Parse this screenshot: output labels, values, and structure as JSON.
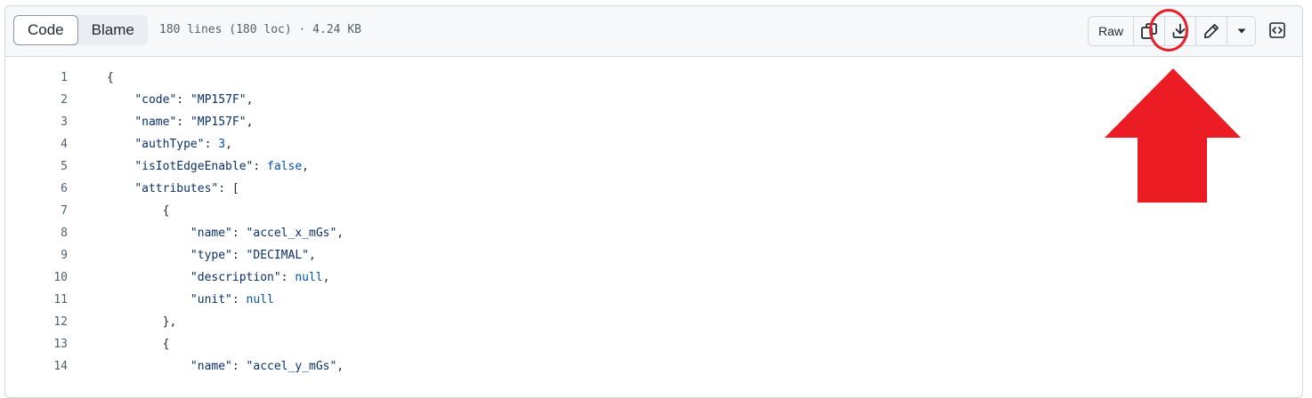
{
  "view_tabs": [
    {
      "label": "Code",
      "active": true
    },
    {
      "label": "Blame",
      "active": false
    }
  ],
  "file_meta": "180 lines (180 loc) · 4.24 KB",
  "toolbar": {
    "raw_label": "Raw",
    "copy_icon": "copy-icon",
    "download_icon": "download-icon",
    "edit_icon": "pencil-icon",
    "more_icon": "triangle-down-icon",
    "symbols_icon": "code-square-icon"
  },
  "annotation": {
    "color": "#e8202a",
    "highlight": "download-button",
    "arrow_direction": "up"
  },
  "code_lines": [
    {
      "n": "1",
      "indent": "",
      "tokens": [
        [
          "p",
          "{"
        ]
      ]
    },
    {
      "n": "2",
      "indent": "    ",
      "tokens": [
        [
          "s",
          "\"code\""
        ],
        [
          "p",
          ": "
        ],
        [
          "s",
          "\"MP157F\""
        ],
        [
          "p",
          ","
        ]
      ]
    },
    {
      "n": "3",
      "indent": "    ",
      "tokens": [
        [
          "s",
          "\"name\""
        ],
        [
          "p",
          ": "
        ],
        [
          "s",
          "\"MP157F\""
        ],
        [
          "p",
          ","
        ]
      ]
    },
    {
      "n": "4",
      "indent": "    ",
      "tokens": [
        [
          "s",
          "\"authType\""
        ],
        [
          "p",
          ": "
        ],
        [
          "n",
          "3"
        ],
        [
          "p",
          ","
        ]
      ]
    },
    {
      "n": "5",
      "indent": "    ",
      "tokens": [
        [
          "s",
          "\"isIotEdgeEnable\""
        ],
        [
          "p",
          ": "
        ],
        [
          "k",
          "false"
        ],
        [
          "p",
          ","
        ]
      ]
    },
    {
      "n": "6",
      "indent": "    ",
      "tokens": [
        [
          "s",
          "\"attributes\""
        ],
        [
          "p",
          ": ["
        ]
      ]
    },
    {
      "n": "7",
      "indent": "        ",
      "tokens": [
        [
          "p",
          "{"
        ]
      ]
    },
    {
      "n": "8",
      "indent": "            ",
      "tokens": [
        [
          "s",
          "\"name\""
        ],
        [
          "p",
          ": "
        ],
        [
          "s",
          "\"accel_x_mGs\""
        ],
        [
          "p",
          ","
        ]
      ]
    },
    {
      "n": "9",
      "indent": "            ",
      "tokens": [
        [
          "s",
          "\"type\""
        ],
        [
          "p",
          ": "
        ],
        [
          "s",
          "\"DECIMAL\""
        ],
        [
          "p",
          ","
        ]
      ]
    },
    {
      "n": "10",
      "indent": "            ",
      "tokens": [
        [
          "s",
          "\"description\""
        ],
        [
          "p",
          ": "
        ],
        [
          "k",
          "null"
        ],
        [
          "p",
          ","
        ]
      ]
    },
    {
      "n": "11",
      "indent": "            ",
      "tokens": [
        [
          "s",
          "\"unit\""
        ],
        [
          "p",
          ": "
        ],
        [
          "k",
          "null"
        ]
      ]
    },
    {
      "n": "12",
      "indent": "        ",
      "tokens": [
        [
          "p",
          "},"
        ]
      ]
    },
    {
      "n": "13",
      "indent": "        ",
      "tokens": [
        [
          "p",
          "{"
        ]
      ]
    },
    {
      "n": "14",
      "indent": "            ",
      "tokens": [
        [
          "s",
          "\"name\""
        ],
        [
          "p",
          ": "
        ],
        [
          "s",
          "\"accel_y_mGs\""
        ],
        [
          "p",
          ","
        ]
      ]
    }
  ]
}
